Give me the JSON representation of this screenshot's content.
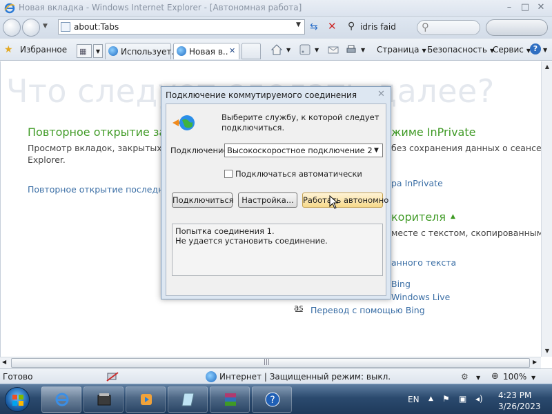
{
  "window": {
    "title": "Новая вкладка - Windows Internet Explorer - [Автономная работа]",
    "controls": [
      "–",
      "□",
      "✕"
    ]
  },
  "address_bar": {
    "url": "about:Tabs",
    "search_text": "idris faid"
  },
  "favorites_bar": {
    "favorites_label": "Избранное",
    "tabs": [
      {
        "label": "Использует..."
      },
      {
        "label": "Новая в...",
        "active": true
      }
    ],
    "commands": {
      "page": "Страница",
      "safety": "Безопасность",
      "tools": "Сервис",
      "help": "?"
    }
  },
  "content": {
    "watermark": "Что следует сделать далее?",
    "reopen_heading": "Повторное открытие зак",
    "reopen_desc_line1": "Просмотр вкладок, закрытых с н",
    "reopen_desc_line2": "Explorer.",
    "reopen_link": "Повторное открытие последнег",
    "inprivate_heading": "жиме InPrivate",
    "inprivate_desc": "без сохранения данных о сеансе",
    "inprivate_link": "ра InPrivate",
    "accel_heading": "корителя",
    "accel_desc": "месте с текстом, скопированным с н",
    "accel_items": [
      "анного текста",
      "Bing",
      "Windows Live",
      "Перевод с помощью Bing"
    ]
  },
  "dialog": {
    "title": "Подключение коммутируемого соединения",
    "prompt_line1": "Выберите службу, к которой следует",
    "prompt_line2": "подключиться.",
    "connection_label": "Подключение:",
    "connection_value": "Высокоскоростное подключение 2",
    "auto_connect_label": "Подключаться автоматически",
    "auto_connect_checked": false,
    "buttons": {
      "connect": "Подключиться",
      "settings": "Настройка...",
      "offline": "Работать автономно"
    },
    "status_lines": [
      "Попытка соединения 1.",
      "Не удается установить соединение."
    ]
  },
  "status_bar": {
    "left": "Готово",
    "zone": "Интернет | Защищенный режим: выкл.",
    "zoom": "100%"
  },
  "taskbar": {
    "lang": "EN",
    "time": "4:23 PM",
    "date": "3/26/2023"
  },
  "colors": {
    "green_heading": "#3f9a25",
    "link": "#3a6ea5",
    "taskbar": "#2b4a6e"
  }
}
